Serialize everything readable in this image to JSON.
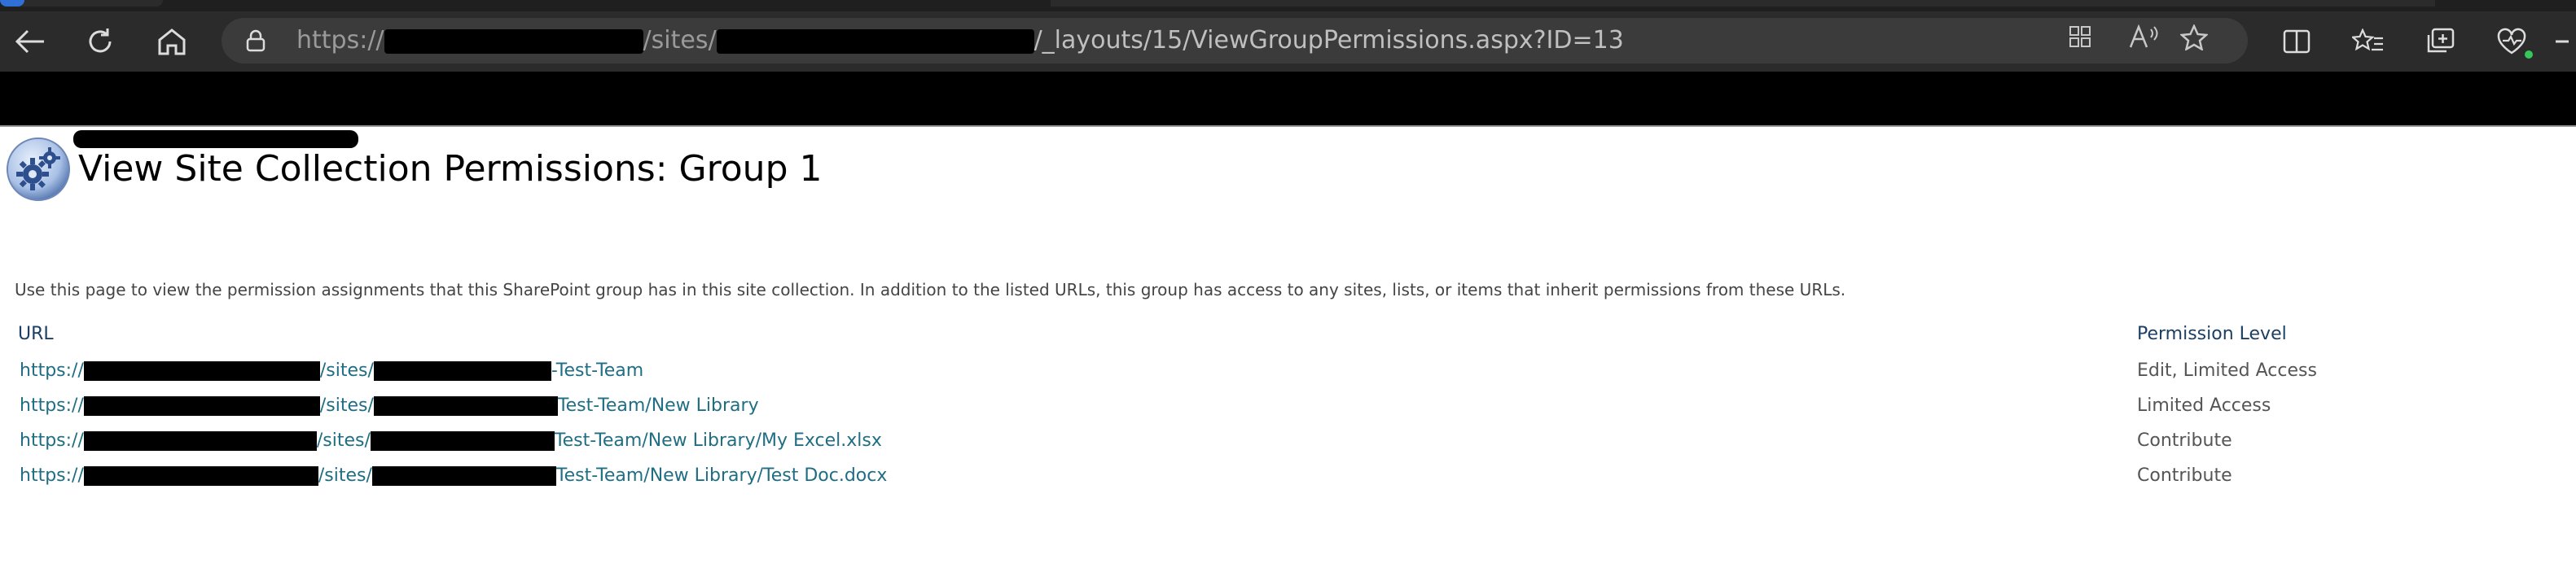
{
  "browser": {
    "url_prefix": "https://",
    "url_mid": "/sites/",
    "url_suffix": "/_layouts/15/ViewGroupPermissions.aspx?ID=13"
  },
  "page": {
    "title": "View Site Collection Permissions: Group 1",
    "description": "Use this page to view the permission assignments that this SharePoint group has in this site collection. In addition to the listed URLs, this group has access to any sites, lists, or items that inherit permissions from these URLs."
  },
  "table": {
    "headers": {
      "url": "URL",
      "permission": "Permission Level"
    },
    "rows": [
      {
        "prefix": "https://",
        "mid": "/sites/",
        "suffix": "-Test-Team",
        "permission": "Edit, Limited Access"
      },
      {
        "prefix": "https://",
        "mid": "/sites/",
        "suffix": "Test-Team/New Library",
        "permission": "Limited Access"
      },
      {
        "prefix": "https://",
        "mid": "/sites/",
        "suffix": "Test-Team/New Library/My Excel.xlsx",
        "permission": "Contribute"
      },
      {
        "prefix": "https://",
        "mid": "/sites/",
        "suffix": "Test-Team/New Library/Test Doc.docx",
        "permission": "Contribute"
      }
    ]
  },
  "icons": {
    "back": "back-arrow-icon",
    "refresh": "refresh-icon",
    "home": "home-icon",
    "lock": "lock-icon",
    "app": "app-grid-icon",
    "read_aloud": "read-aloud-icon",
    "favorite": "star-icon",
    "split": "split-screen-icon",
    "favorites": "favorites-list-icon",
    "collections": "collections-icon",
    "health": "browser-essentials-icon",
    "site": "site-settings-gear-icon"
  },
  "colors": {
    "link": "#1f6e83",
    "header": "#1c3f63",
    "toolbar": "#2b2b2b",
    "suite_bar": "#000000"
  }
}
